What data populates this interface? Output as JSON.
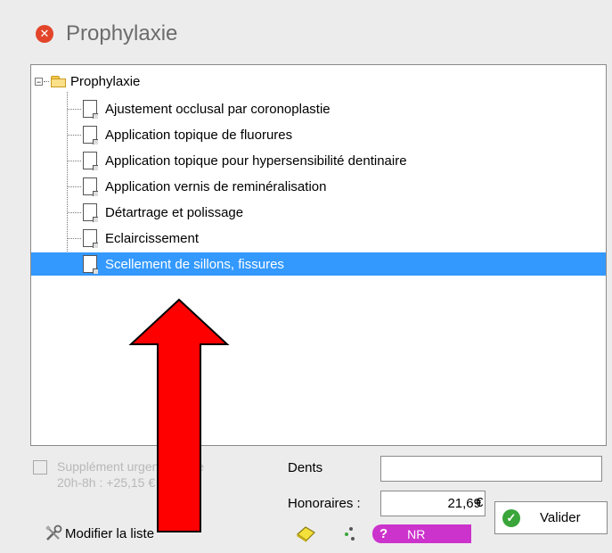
{
  "window": {
    "title": "Prophylaxie"
  },
  "tree": {
    "root_label": "Prophylaxie",
    "items": [
      {
        "label": "Ajustement occlusal par coronoplastie"
      },
      {
        "label": "Application topique de fluorures"
      },
      {
        "label": "Application topique pour hypersensibilité dentinaire"
      },
      {
        "label": "Application vernis de reminéralisation"
      },
      {
        "label": "Détartrage et polissage"
      },
      {
        "label": "Eclaircissement"
      },
      {
        "label": "Scellement de sillons, fissures",
        "selected": true
      }
    ]
  },
  "supplement": {
    "line1": "Supplément urgence entre",
    "line2": "20h-8h : +25,15 €",
    "checked": false
  },
  "fields": {
    "dents_label": "Dents",
    "dents_value": "",
    "honoraires_label": "Honoraires :",
    "honoraires_value": "21,69",
    "currency": "€"
  },
  "buttons": {
    "valider": "Valider",
    "modifier_liste": "Modifier la liste"
  },
  "nr_badge": {
    "symbol": "?",
    "label": "NR"
  },
  "colors": {
    "selection": "#3399ff",
    "arrow": "#ff0000",
    "badge": "#cc33cc",
    "close": "#e2452a"
  }
}
